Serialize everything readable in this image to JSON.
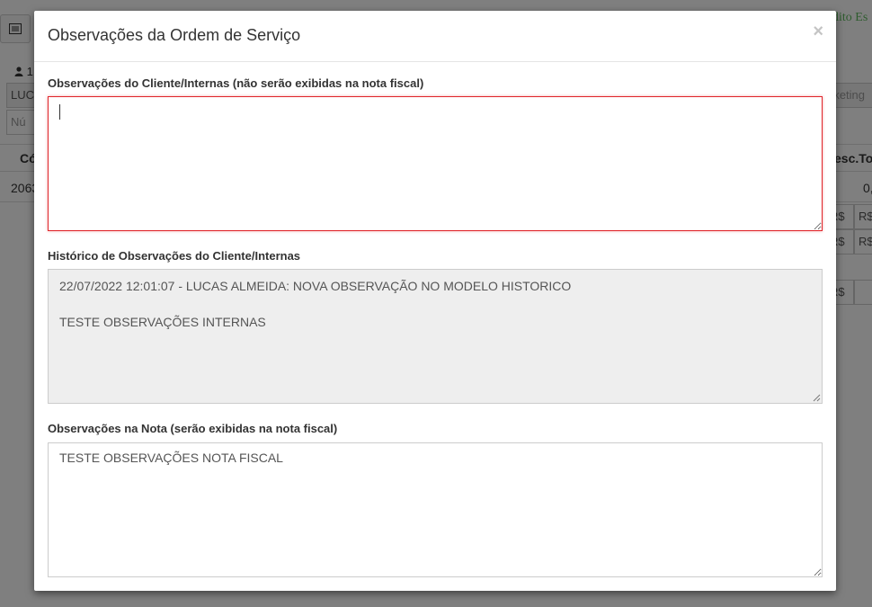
{
  "background": {
    "top_right_text": "dito Es",
    "user_count": "1",
    "client_partial": "LUC",
    "number_partial": "Nú",
    "marketing_partial": "rketing",
    "col_code_partial": "Có",
    "col_desc_total_partial": "esc.To",
    "row_code_partial": "2063",
    "row_value_partial": "0,",
    "currency_a": "R$",
    "currency_b": "R$",
    "currency_c": "R$",
    "currency_d": "R$",
    "currency_e": "R$"
  },
  "modal": {
    "title": "Observações da Ordem de Serviço",
    "close_label": "×",
    "client_obs": {
      "label": "Observações do Cliente/Internas (não serão exibidas na nota fiscal)",
      "value": ""
    },
    "history": {
      "label": "Histórico de Observações do Cliente/Internas",
      "value": "22/07/2022 12:01:07 - LUCAS ALMEIDA: NOVA OBSERVAÇÃO NO MODELO HISTORICO\n\nTESTE OBSERVAÇÕES INTERNAS"
    },
    "invoice_obs": {
      "label": "Observações na Nota (serão exibidas na nota fiscal)",
      "value": "TESTE OBSERVAÇÕES NOTA FISCAL"
    }
  },
  "colors": {
    "overlay": "#808080",
    "active_border": "#e0262b",
    "readonly_bg": "#eeeeee"
  }
}
